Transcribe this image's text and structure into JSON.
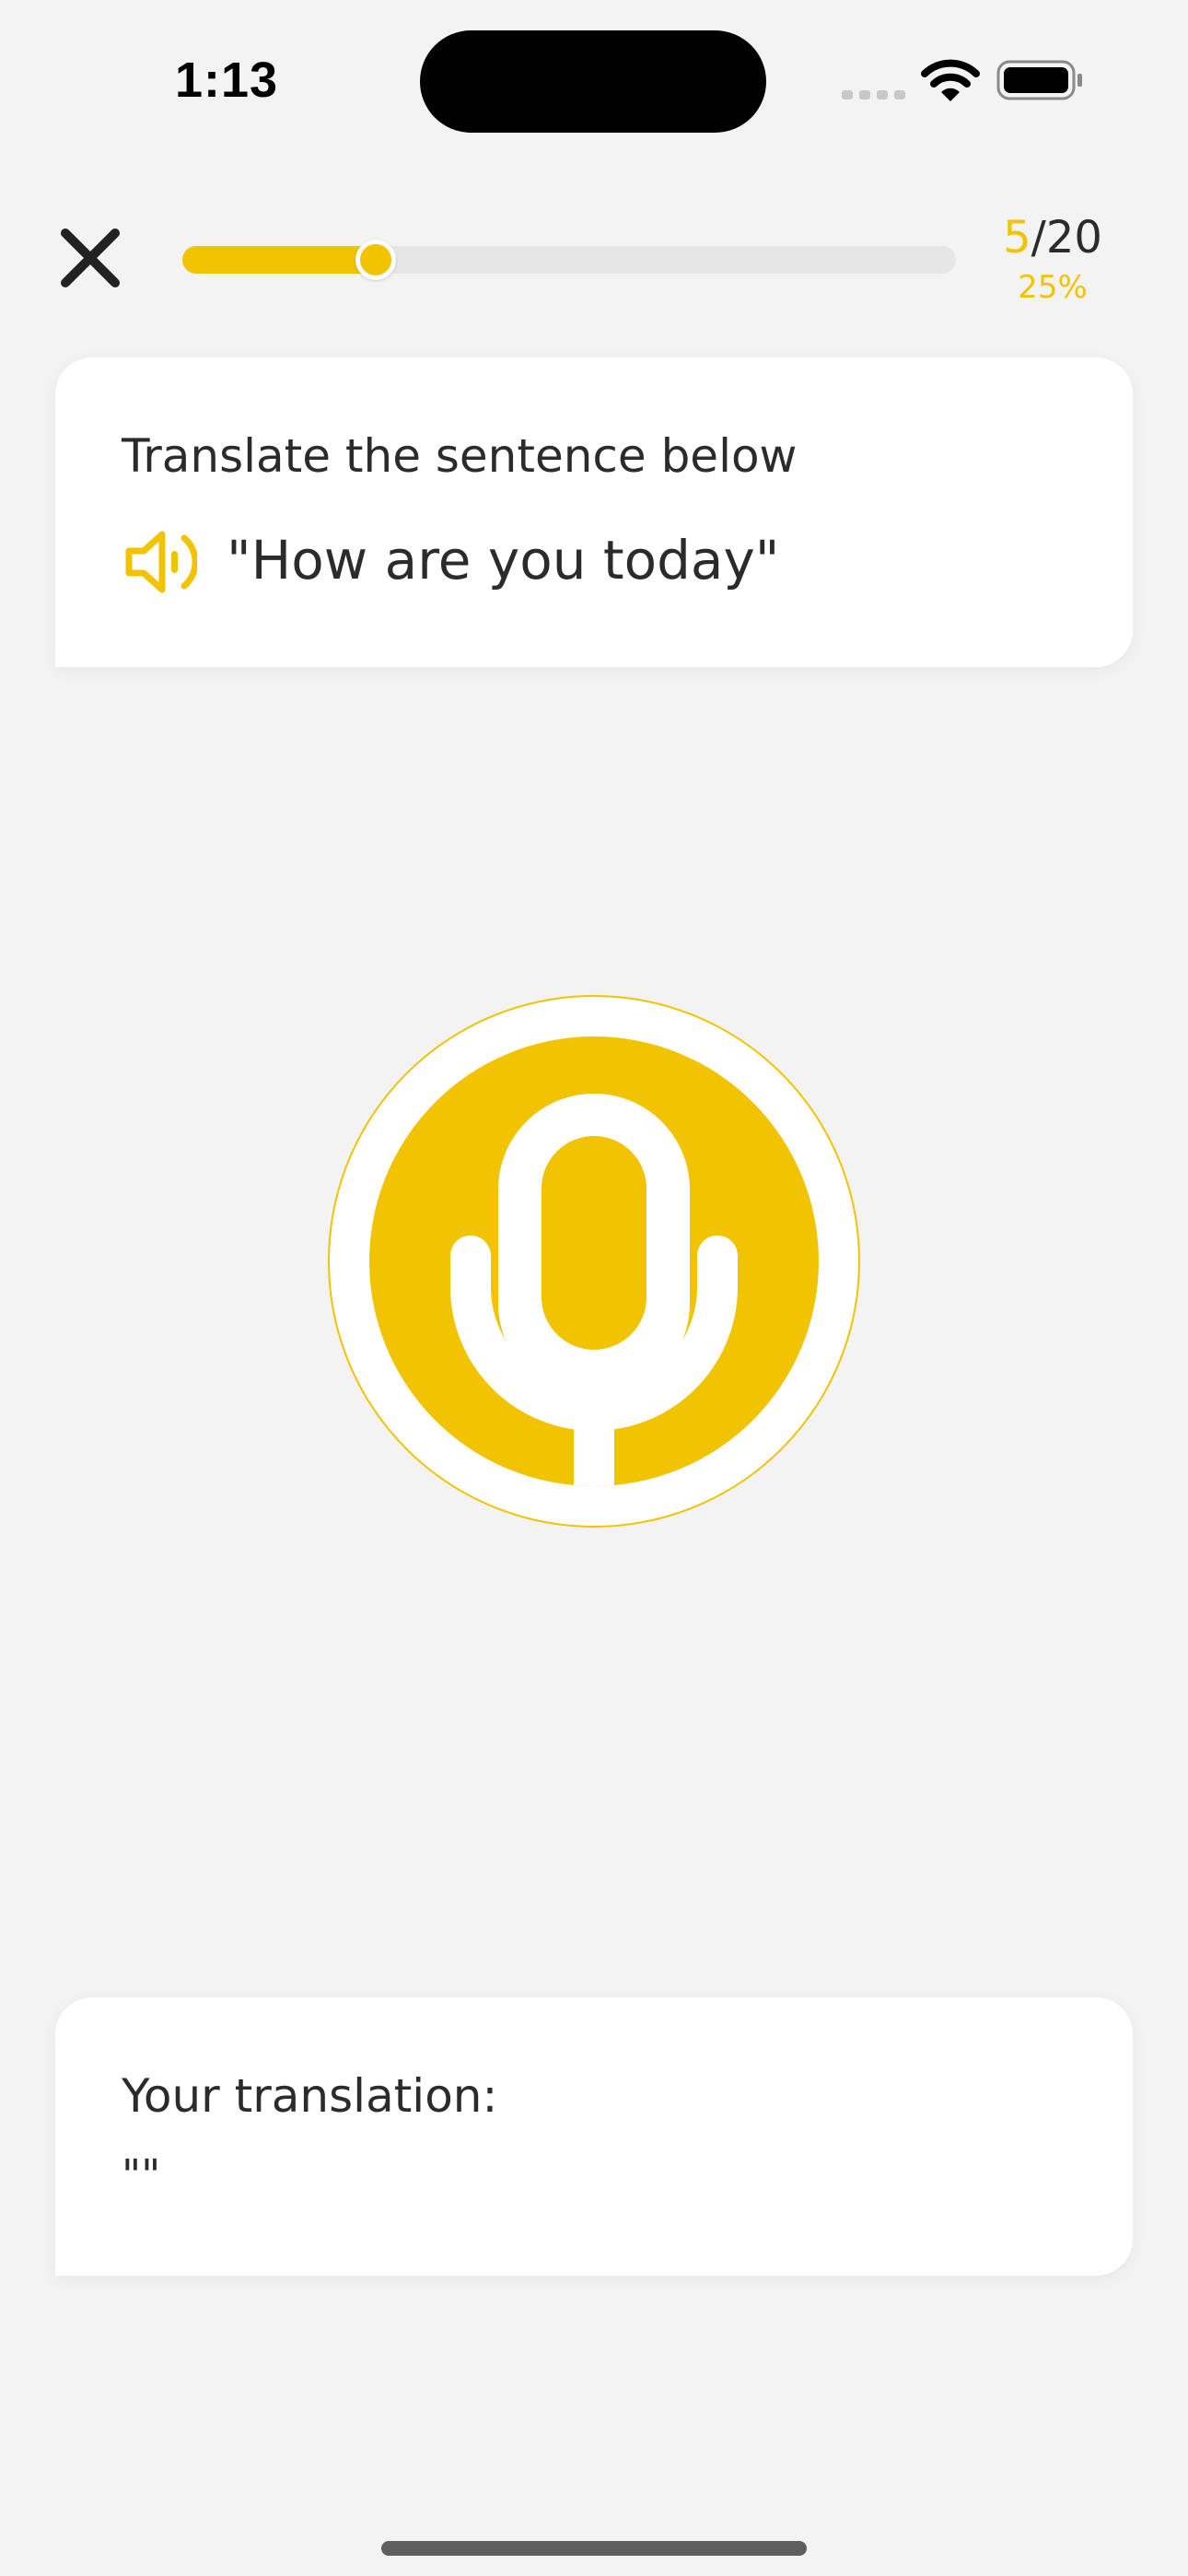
{
  "status": {
    "time": "1:13"
  },
  "header": {
    "progress_fraction": 0.25,
    "current": "5",
    "separator": "/",
    "total": "20",
    "percent": "25%"
  },
  "prompt": {
    "label": "Translate the sentence below",
    "sentence": "\"How are you today\""
  },
  "answer": {
    "label": "Your translation:",
    "value": "\"\""
  },
  "colors": {
    "accent": "#f2c300",
    "background": "#f3f3f3",
    "card": "#ffffff",
    "text": "#2b2b2b"
  },
  "icons": {
    "close": "close-icon",
    "speaker": "speaker-icon",
    "mic": "microphone-icon"
  }
}
